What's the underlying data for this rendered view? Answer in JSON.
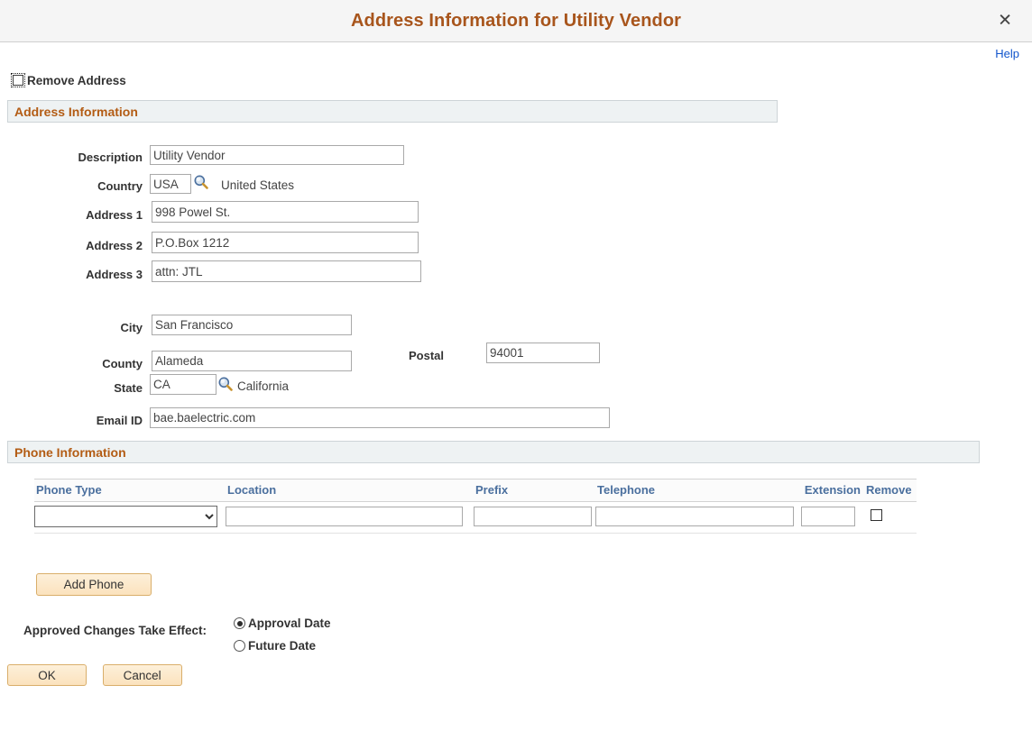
{
  "window": {
    "title": "Address Information for Utility Vendor",
    "close_icon": "close-icon",
    "close_glyph": "✕",
    "help_label": "Help",
    "title_color": "#a8551c"
  },
  "remove_address": {
    "label": "Remove Address",
    "checked": false
  },
  "address_section": {
    "title": "Address Information",
    "fields": {
      "description": {
        "label": "Description",
        "value": "Utility Vendor"
      },
      "country": {
        "label": "Country",
        "value": "USA",
        "lookup_icon": "magnifier-icon",
        "resolved": "United States"
      },
      "address1": {
        "label": "Address 1",
        "value": "998 Powel St."
      },
      "address2": {
        "label": "Address 2",
        "value": "P.O.Box 1212"
      },
      "address3": {
        "label": "Address 3",
        "value": "attn: JTL"
      },
      "city": {
        "label": "City",
        "value": "San Francisco"
      },
      "county": {
        "label": "County",
        "value": "Alameda"
      },
      "postal": {
        "label": "Postal",
        "value": "94001"
      },
      "state": {
        "label": "State",
        "value": "CA",
        "lookup_icon": "magnifier-icon",
        "resolved": "California"
      },
      "email": {
        "label": "Email ID",
        "value": "bae.baelectric.com"
      }
    }
  },
  "phone_section": {
    "title": "Phone Information",
    "columns": [
      "Phone Type",
      "Location",
      "Prefix",
      "Telephone",
      "Extension",
      "Remove"
    ],
    "rows": [
      {
        "phone_type": "",
        "phone_type_placeholder": "",
        "location": "",
        "prefix": "",
        "telephone": "",
        "extension": "",
        "remove_checked": false
      }
    ],
    "add_phone_label": "Add Phone"
  },
  "approved_changes": {
    "label": "Approved Changes Take Effect:",
    "options": [
      {
        "label": "Approval Date",
        "selected": true
      },
      {
        "label": "Future Date",
        "selected": false
      }
    ]
  },
  "footer": {
    "ok_label": "OK",
    "cancel_label": "Cancel"
  }
}
